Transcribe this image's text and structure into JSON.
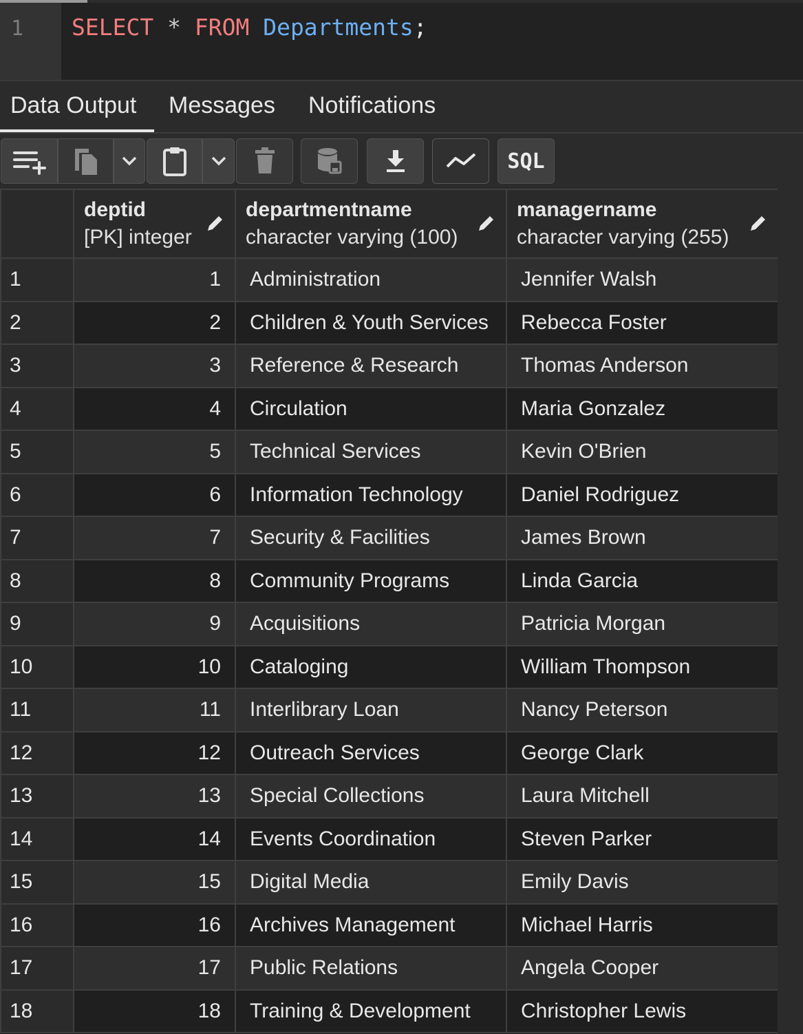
{
  "editor": {
    "line_number": "1",
    "tokens": {
      "select": "SELECT",
      "star": "*",
      "from": "FROM",
      "table": "Departments",
      "semicolon": ";"
    }
  },
  "tabs": [
    {
      "label": "Data Output",
      "active": true
    },
    {
      "label": "Messages",
      "active": false
    },
    {
      "label": "Notifications",
      "active": false
    }
  ],
  "toolbar": {
    "buttons": [
      {
        "icon": "add-row-icon"
      },
      {
        "icon": "copy-icon"
      },
      {
        "icon": "chevron-down-icon"
      },
      {
        "icon": "paste-icon"
      },
      {
        "icon": "chevron-down-icon"
      },
      {
        "icon": "delete-icon"
      },
      {
        "icon": "save-data-icon"
      },
      {
        "icon": "download-icon"
      },
      {
        "icon": "graph-icon"
      },
      {
        "icon": "sql-icon",
        "label": "SQL"
      }
    ]
  },
  "grid": {
    "columns": [
      {
        "name": "deptid",
        "type": "[PK] integer"
      },
      {
        "name": "departmentname",
        "type": "character varying (100)"
      },
      {
        "name": "managername",
        "type": "character varying (255)"
      }
    ],
    "rows": [
      {
        "n": "1",
        "deptid": "1",
        "departmentname": "Administration",
        "managername": "Jennifer Walsh"
      },
      {
        "n": "2",
        "deptid": "2",
        "departmentname": "Children & Youth Services",
        "managername": "Rebecca Foster"
      },
      {
        "n": "3",
        "deptid": "3",
        "departmentname": "Reference & Research",
        "managername": "Thomas Anderson"
      },
      {
        "n": "4",
        "deptid": "4",
        "departmentname": "Circulation",
        "managername": "Maria Gonzalez"
      },
      {
        "n": "5",
        "deptid": "5",
        "departmentname": "Technical Services",
        "managername": "Kevin O'Brien"
      },
      {
        "n": "6",
        "deptid": "6",
        "departmentname": "Information Technology",
        "managername": "Daniel Rodriguez"
      },
      {
        "n": "7",
        "deptid": "7",
        "departmentname": "Security & Facilities",
        "managername": "James Brown"
      },
      {
        "n": "8",
        "deptid": "8",
        "departmentname": "Community Programs",
        "managername": "Linda Garcia"
      },
      {
        "n": "9",
        "deptid": "9",
        "departmentname": "Acquisitions",
        "managername": "Patricia Morgan"
      },
      {
        "n": "10",
        "deptid": "10",
        "departmentname": "Cataloging",
        "managername": "William Thompson"
      },
      {
        "n": "11",
        "deptid": "11",
        "departmentname": "Interlibrary Loan",
        "managername": "Nancy Peterson"
      },
      {
        "n": "12",
        "deptid": "12",
        "departmentname": "Outreach Services",
        "managername": "George Clark"
      },
      {
        "n": "13",
        "deptid": "13",
        "departmentname": "Special Collections",
        "managername": "Laura Mitchell"
      },
      {
        "n": "14",
        "deptid": "14",
        "departmentname": "Events Coordination",
        "managername": "Steven Parker"
      },
      {
        "n": "15",
        "deptid": "15",
        "departmentname": "Digital Media",
        "managername": "Emily Davis"
      },
      {
        "n": "16",
        "deptid": "16",
        "departmentname": "Archives Management",
        "managername": "Michael Harris"
      },
      {
        "n": "17",
        "deptid": "17",
        "departmentname": "Public Relations",
        "managername": "Angela Cooper"
      },
      {
        "n": "18",
        "deptid": "18",
        "departmentname": "Training & Development",
        "managername": "Christopher Lewis"
      }
    ]
  },
  "colors": {
    "keyword": "#f37d7d",
    "identifier": "#6cb0f4",
    "background": "#222222"
  }
}
